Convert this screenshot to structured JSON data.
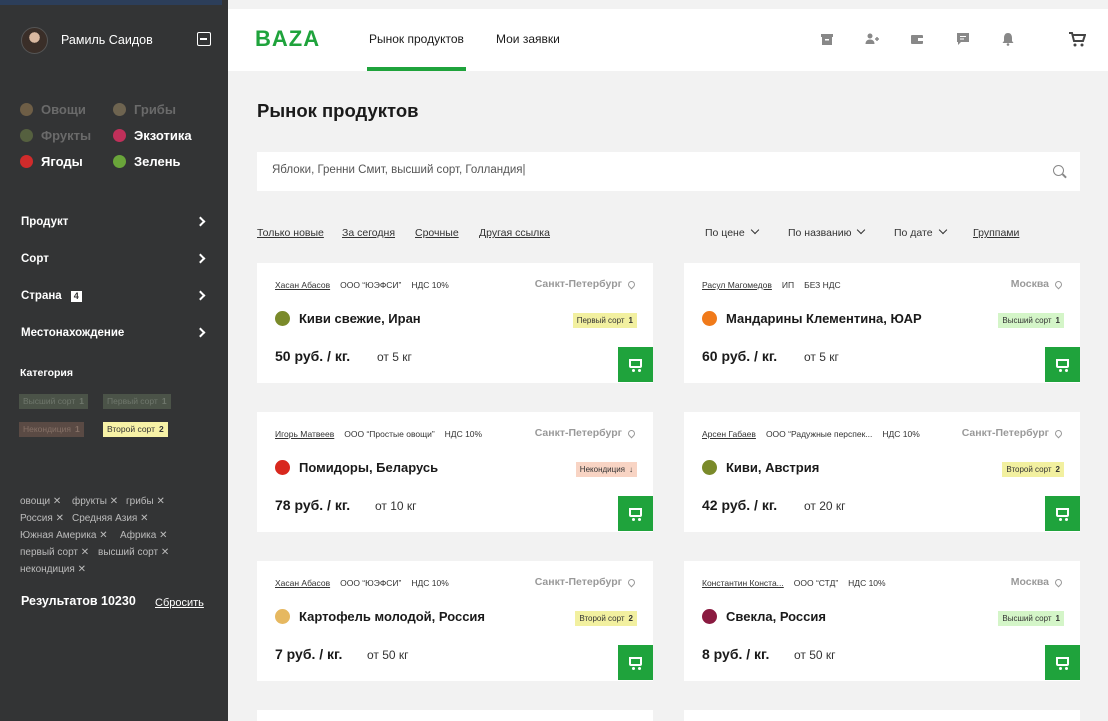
{
  "user": {
    "name": "Рамиль Саидов"
  },
  "categories": [
    {
      "label": "Овощи",
      "active": false,
      "color": "#7a6a50"
    },
    {
      "label": "Грибы",
      "active": false,
      "color": "#7a6a50"
    },
    {
      "label": "Фрукты",
      "active": false,
      "color": "#5e6e45"
    },
    {
      "label": "Экзотика",
      "active": true,
      "color": "#c0305a"
    },
    {
      "label": "Ягоды",
      "active": true,
      "color": "#d02b2b"
    },
    {
      "label": "Зелень",
      "active": true,
      "color": "#6aa53a"
    }
  ],
  "filters": [
    {
      "label": "Продукт"
    },
    {
      "label": "Сорт"
    },
    {
      "label": "Страна",
      "count": "4"
    },
    {
      "label": "Местонахождение"
    }
  ],
  "category_section": {
    "title": "Категория",
    "tags": [
      {
        "label": "Высший сорт",
        "num": "1"
      },
      {
        "label": "Первый сорт",
        "num": "1"
      },
      {
        "label": "Некондиция",
        "num": "1"
      },
      {
        "label": "Второй сорт",
        "num": "2"
      }
    ]
  },
  "chips": [
    "овощи ✕",
    "фрукты ✕",
    "грибы ✕",
    "Россия ✕",
    "Средняя Азия ✕",
    "Южная Америка ✕",
    "Африка ✕",
    "первый сорт ✕",
    "высший сорт ✕",
    "некондиция ✕"
  ],
  "results": {
    "label": "Результатов 10230",
    "reset": "Сбросить"
  },
  "header": {
    "logo": "BAZA",
    "nav": [
      "Рынок продуктов",
      "Мои заявки"
    ]
  },
  "main": {
    "title": "Рынок продуктов",
    "search_value": "Яблоки, Гренни Смит, высший сорт, Голландия|",
    "quick_links": [
      "Только новые",
      "За сегодня",
      "Срочные",
      "Другая ссылка"
    ],
    "sorts": [
      "По цене",
      "По названию",
      "По дате"
    ],
    "group_link": "Группами"
  },
  "cards": [
    {
      "seller": "Хасан Абасов",
      "company": "ООО “ЮЭФСИ”",
      "vat": "НДС 10%",
      "city": "Санкт-Петербург",
      "product": "Киви свежие, Иран",
      "grade": "Первый сорт",
      "grade_num": "1",
      "grade_color": "#f2f0a0",
      "dot_color": "#7a8a2a",
      "price": "50 руб. / кг.",
      "min": "от 5 кг"
    },
    {
      "seller": "Расул Магомедов",
      "company": "ИП",
      "vat": "БЕЗ НДС",
      "city": "Москва",
      "product": "Мандарины Клементина, ЮАР",
      "grade": "Высший сорт",
      "grade_num": "1",
      "grade_color": "#d4f5c8",
      "dot_color": "#f07a1a",
      "price": "60 руб. / кг.",
      "min": "от 5 кг"
    },
    {
      "seller": "Игорь Матвеев",
      "company": "ООО “Простые овощи”",
      "vat": "НДС 10%",
      "city": "Санкт-Петербург",
      "product": "Помидоры, Беларусь",
      "grade": "Некондиция",
      "grade_num": "↓",
      "grade_color": "#f8d4c4",
      "dot_color": "#d8281e",
      "price": "78 руб. / кг.",
      "min": "от 10 кг"
    },
    {
      "seller": "Арсен Габаев",
      "company": "ООО “Радужные перспек...",
      "vat": "НДС 10%",
      "city": "Санкт-Петербург",
      "product": "Киви, Австрия",
      "grade": "Второй сорт",
      "grade_num": "2",
      "grade_color": "#f2f0a0",
      "dot_color": "#7a8a2a",
      "price": "42 руб. / кг.",
      "min": "от 20 кг"
    },
    {
      "seller": "Хасан Абасов",
      "company": "ООО “ЮЭФСИ”",
      "vat": "НДС 10%",
      "city": "Санкт-Петербург",
      "product": "Картофель молодой, Россия",
      "grade": "Второй сорт",
      "grade_num": "2",
      "grade_color": "#f2f0a0",
      "dot_color": "#e6b860",
      "price": "7 руб. / кг.",
      "min": "от 50 кг"
    },
    {
      "seller": "Константин Конста...",
      "company": "ООО “СТД”",
      "vat": "НДС 10%",
      "city": "Москва",
      "product": "Свекла, Россия",
      "grade": "Высший сорт",
      "grade_num": "1",
      "grade_color": "#d4f5c8",
      "dot_color": "#8a1a40",
      "price": "8 руб. / кг.",
      "min": "от 50 кг"
    }
  ],
  "colors": {
    "accent": "#1fa33c",
    "sidebar": "#333435"
  }
}
